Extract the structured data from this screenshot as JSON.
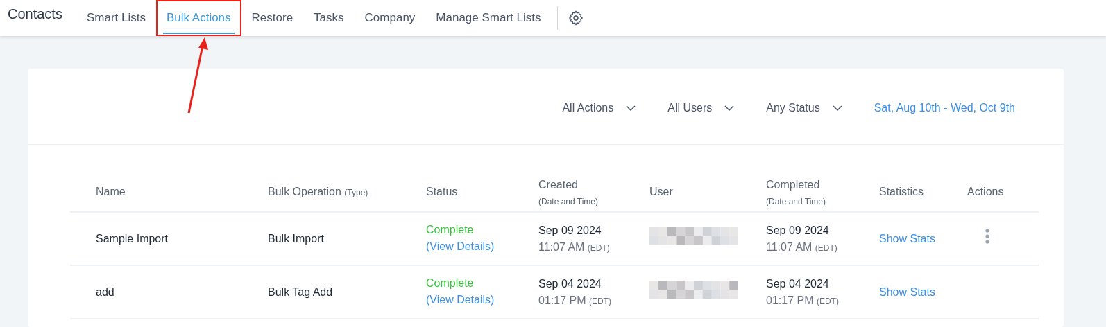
{
  "app_title": "Contacts",
  "tabs": [
    {
      "label": "Smart Lists",
      "selected": false,
      "highlighted": false
    },
    {
      "label": "Bulk Actions",
      "selected": true,
      "highlighted": true
    },
    {
      "label": "Restore",
      "selected": false,
      "highlighted": false
    },
    {
      "label": "Tasks",
      "selected": false,
      "highlighted": false
    },
    {
      "label": "Company",
      "selected": false,
      "highlighted": false
    },
    {
      "label": "Manage Smart Lists",
      "selected": false,
      "highlighted": false
    }
  ],
  "filters": [
    {
      "label": "All Actions"
    },
    {
      "label": "All Users"
    },
    {
      "label": "Any Status"
    }
  ],
  "date_range": "Sat, Aug 10th - Wed, Oct 9th",
  "table": {
    "columns": [
      {
        "label": "Name"
      },
      {
        "label": "Bulk Operation",
        "note": "(Type)"
      },
      {
        "label": "Status"
      },
      {
        "label": "Created",
        "sub": "(Date and Time)"
      },
      {
        "label": "User"
      },
      {
        "label": "Completed",
        "sub": "(Date and Time)"
      },
      {
        "label": "Statistics"
      },
      {
        "label": "Actions"
      }
    ],
    "rows": [
      {
        "name": "Sample Import",
        "operation": "Bulk Import",
        "status": "Complete",
        "details": "(View Details)",
        "created_date": "Sep 09 2024",
        "created_time": "11:07 AM",
        "created_tz": "(EDT)",
        "completed_date": "Sep 09 2024",
        "completed_time": "11:07 AM",
        "completed_tz": "(EDT)",
        "stats": "Show Stats",
        "menu": true
      },
      {
        "name": "add",
        "operation": "Bulk Tag Add",
        "status": "Complete",
        "details": "(View Details)",
        "created_date": "Sep 04 2024",
        "created_time": "01:17 PM",
        "created_tz": "(EDT)",
        "completed_date": "Sep 04 2024",
        "completed_time": "01:17 PM",
        "completed_tz": "(EDT)",
        "stats": "Show Stats",
        "menu": false
      }
    ]
  }
}
